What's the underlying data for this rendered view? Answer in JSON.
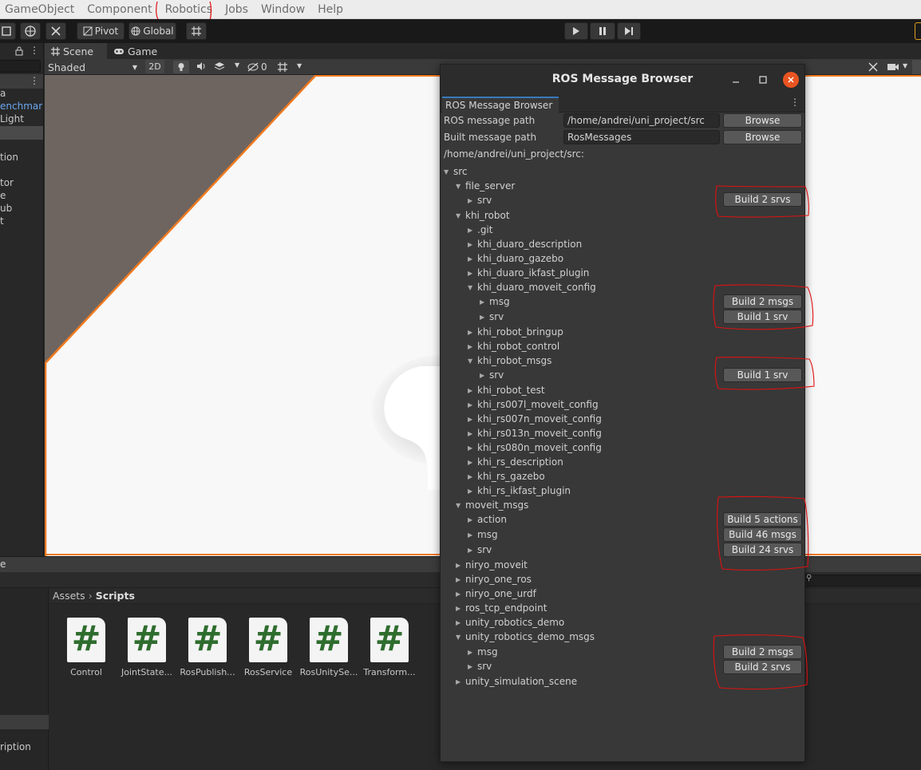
{
  "menubar": {
    "items": [
      "GameObject",
      "Component",
      "Robotics",
      "Jobs",
      "Window",
      "Help"
    ]
  },
  "toolbar": {
    "pivot_label": "Pivot",
    "global_label": "Global"
  },
  "hierarchy": {
    "rows": [
      "a",
      "enchmark",
      "Light",
      "tion",
      "tor",
      "e",
      "ub",
      "t"
    ]
  },
  "scene": {
    "tab_scene": "Scene",
    "tab_game": "Game",
    "shading_mode": "Shaded",
    "mode_2d": "2D",
    "hidden_count": "0"
  },
  "project": {
    "panel_title_fragment": "e",
    "breadcrumb": [
      "Assets",
      "Scripts"
    ],
    "left_label": "ription",
    "assets": [
      {
        "label": "Control"
      },
      {
        "label": "JointState..."
      },
      {
        "label": "RosPublish..."
      },
      {
        "label": "RosService"
      },
      {
        "label": "RosUnitySe..."
      },
      {
        "label": "Transform..."
      }
    ]
  },
  "ros_browser": {
    "title": "ROS Message Browser",
    "tab_label": "ROS Message Browser",
    "ros_path_label": "ROS message path",
    "ros_path_value": "/home/andrei/uni_project/src",
    "built_path_label": "Built message path",
    "built_path_value": "RosMessages",
    "browse_label": "Browse",
    "root_path": "/home/andrei/uni_project/src:",
    "tree": [
      {
        "label": "src",
        "level": 0,
        "expanded": true
      },
      {
        "label": "file_server",
        "level": 1,
        "expanded": true
      },
      {
        "label": "srv",
        "level": 2,
        "expanded": false,
        "build": "Build 2 srvs"
      },
      {
        "label": "khi_robot",
        "level": 1,
        "expanded": true
      },
      {
        "label": ".git",
        "level": 2,
        "expanded": false
      },
      {
        "label": "khi_duaro_description",
        "level": 2,
        "expanded": false
      },
      {
        "label": "khi_duaro_gazebo",
        "level": 2,
        "expanded": false
      },
      {
        "label": "khi_duaro_ikfast_plugin",
        "level": 2,
        "expanded": false
      },
      {
        "label": "khi_duaro_moveit_config",
        "level": 2,
        "expanded": true
      },
      {
        "label": "msg",
        "level": 3,
        "expanded": false,
        "build": "Build 2 msgs"
      },
      {
        "label": "srv",
        "level": 3,
        "expanded": false,
        "build": "Build 1 srv"
      },
      {
        "label": "khi_robot_bringup",
        "level": 2,
        "expanded": false
      },
      {
        "label": "khi_robot_control",
        "level": 2,
        "expanded": false
      },
      {
        "label": "khi_robot_msgs",
        "level": 2,
        "expanded": true
      },
      {
        "label": "srv",
        "level": 3,
        "expanded": false,
        "build": "Build 1 srv"
      },
      {
        "label": "khi_robot_test",
        "level": 2,
        "expanded": false
      },
      {
        "label": "khi_rs007l_moveit_config",
        "level": 2,
        "expanded": false
      },
      {
        "label": "khi_rs007n_moveit_config",
        "level": 2,
        "expanded": false
      },
      {
        "label": "khi_rs013n_moveit_config",
        "level": 2,
        "expanded": false
      },
      {
        "label": "khi_rs080n_moveit_config",
        "level": 2,
        "expanded": false
      },
      {
        "label": "khi_rs_description",
        "level": 2,
        "expanded": false
      },
      {
        "label": "khi_rs_gazebo",
        "level": 2,
        "expanded": false
      },
      {
        "label": "khi_rs_ikfast_plugin",
        "level": 2,
        "expanded": false
      },
      {
        "label": "moveit_msgs",
        "level": 1,
        "expanded": true
      },
      {
        "label": "action",
        "level": 2,
        "expanded": false,
        "build": "Build 5 actions"
      },
      {
        "label": "msg",
        "level": 2,
        "expanded": false,
        "build": "Build 46 msgs"
      },
      {
        "label": "srv",
        "level": 2,
        "expanded": false,
        "build": "Build 24 srvs"
      },
      {
        "label": "niryo_moveit",
        "level": 1,
        "expanded": false
      },
      {
        "label": "niryo_one_ros",
        "level": 1,
        "expanded": false
      },
      {
        "label": "niryo_one_urdf",
        "level": 1,
        "expanded": false
      },
      {
        "label": "ros_tcp_endpoint",
        "level": 1,
        "expanded": false
      },
      {
        "label": "unity_robotics_demo",
        "level": 1,
        "expanded": false
      },
      {
        "label": "unity_robotics_demo_msgs",
        "level": 1,
        "expanded": true
      },
      {
        "label": "msg",
        "level": 2,
        "expanded": false,
        "build": "Build 2 msgs"
      },
      {
        "label": "srv",
        "level": 2,
        "expanded": false,
        "build": "Build 2 srvs"
      },
      {
        "label": "unity_simulation_scene",
        "level": 1,
        "expanded": false
      }
    ]
  },
  "colors": {
    "annotation_red": "#e01010",
    "selection_blue": "#4e91d6",
    "scene_floor_edge": "#f07a1f"
  }
}
